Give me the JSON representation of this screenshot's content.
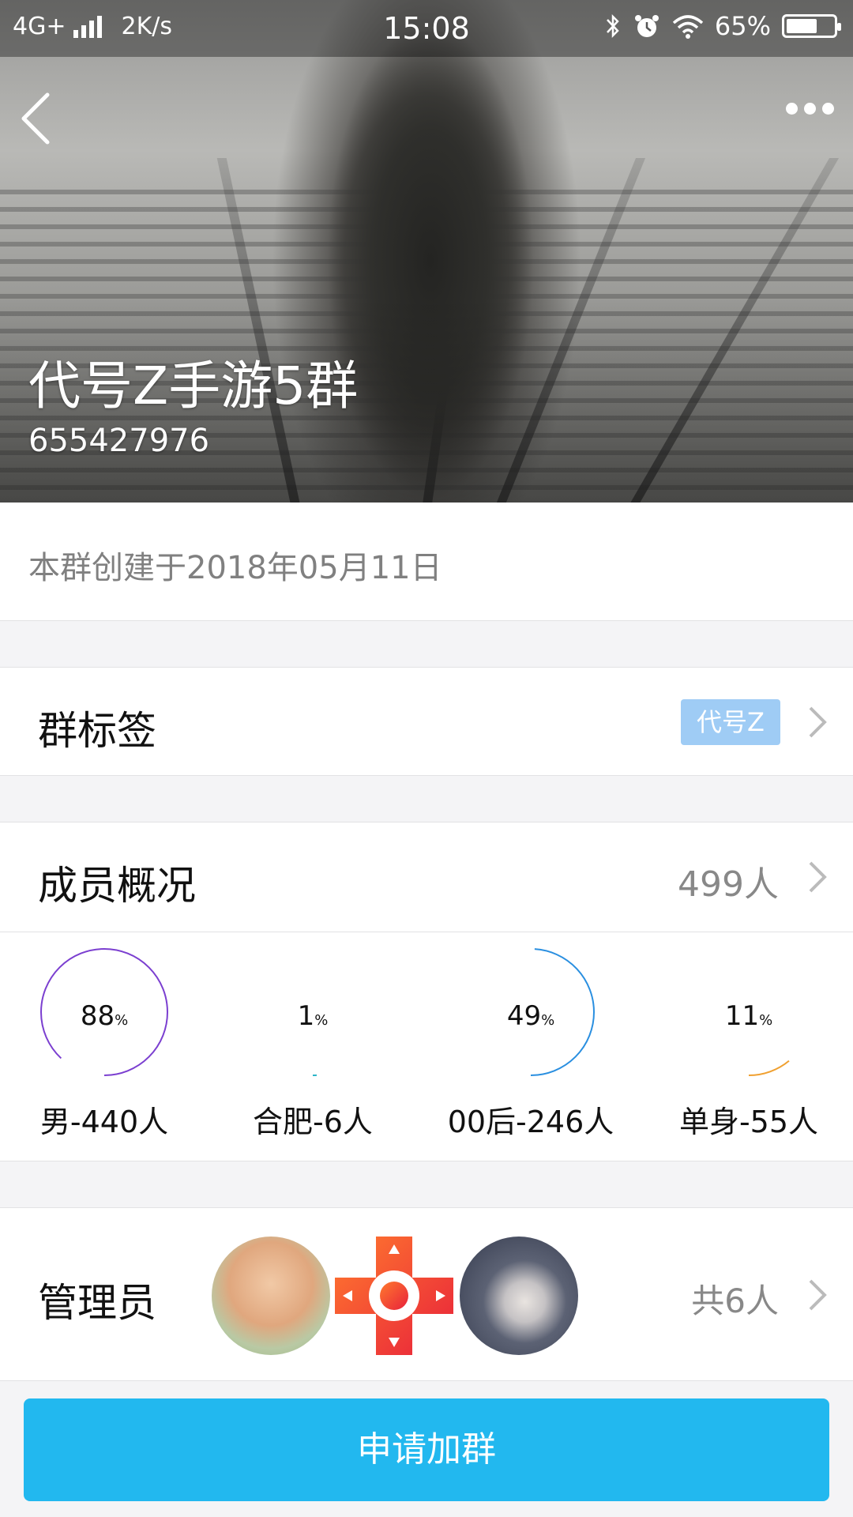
{
  "status_bar": {
    "network": "4G+",
    "speed": "2K/s",
    "time": "15:08",
    "battery": "65%",
    "battery_level": 0.65,
    "icons": [
      "signal-icon",
      "bluetooth-icon",
      "alarm-icon",
      "wifi-icon",
      "battery-icon"
    ]
  },
  "header": {
    "back_icon": "back-arrow-icon",
    "more_icon": "more-dots-icon",
    "group_name": "代号Z手游5群",
    "group_id": "655427976"
  },
  "created": "本群创建于2018年05月11日",
  "tags_section": {
    "title": "群标签",
    "tag": "代号Z",
    "tag_color": "#9fccf5"
  },
  "members_section": {
    "title": "成员概况",
    "count": "499人",
    "stats": [
      {
        "value": "88",
        "unit": "%",
        "label": "男-440人",
        "percent": 88,
        "color": "#7b3fd0"
      },
      {
        "value": "1",
        "unit": "%",
        "label": "合肥-6人",
        "percent": 1,
        "color": "#2bb5c8"
      },
      {
        "value": "49",
        "unit": "%",
        "label": "00后-246人",
        "percent": 49,
        "color": "#2a8fe0"
      },
      {
        "value": "11",
        "unit": "%",
        "label": "单身-55人",
        "percent": 11,
        "color": "#f0a030"
      }
    ]
  },
  "admins_section": {
    "title": "管理员",
    "count": "共6人"
  },
  "join_button": "申请加群",
  "colors": {
    "accent": "#22b8ef",
    "muted_text": "#888888"
  }
}
